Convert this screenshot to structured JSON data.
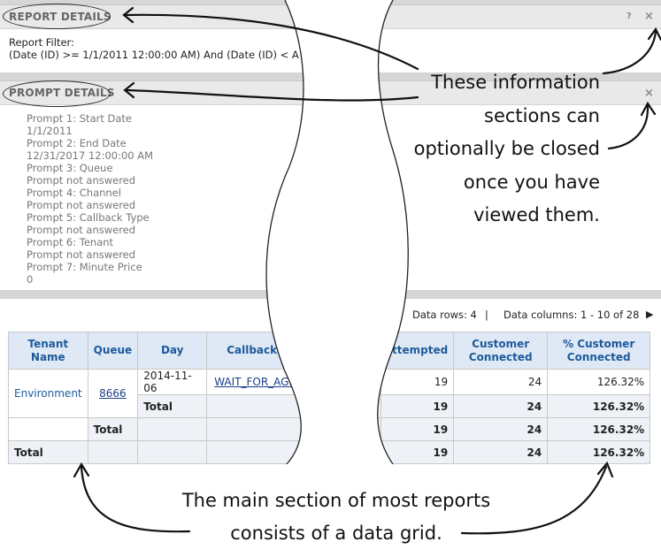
{
  "report_details": {
    "title": "REPORT DETAILS",
    "filter_label": "Report Filter:",
    "filter_value": "(Date (ID) >= 1/1/2011 12:00:00 AM) And (Date (ID) < A",
    "help_icon": "?",
    "close_icon": "×"
  },
  "prompt_details": {
    "title": "PROMPT DETAILS",
    "close_icon": "×",
    "lines": [
      "Prompt 1: Start Date",
      "1/1/2011",
      "Prompt 2: End Date",
      "12/31/2017 12:00:00 AM",
      "Prompt 3: Queue",
      "Prompt not answered",
      "Prompt 4: Channel",
      "Prompt not answered",
      "Prompt 5: Callback Type",
      "Prompt not answered",
      "Prompt 6: Tenant",
      "Prompt not answered",
      "Prompt 7: Minute Price",
      "0"
    ]
  },
  "grid_info": {
    "data_rows": "Data rows: 4",
    "separator": "|",
    "data_columns": "Data columns: 1 - 10 of 28",
    "next_icon": "▶"
  },
  "grid": {
    "headers": [
      "Tenant Name",
      "Queue",
      "Day",
      "Callback Type",
      "ttempted",
      "Customer Connected",
      "% Customer Connected"
    ],
    "rows": [
      {
        "tenant": "Environment",
        "queue": "8666",
        "day": "2014-11-06",
        "callback": "WAIT_FOR_AGEN",
        "attempted": "19",
        "connected": "24",
        "pct": "126.32%"
      },
      {
        "day_total": "Total",
        "attempted": "19",
        "connected": "24",
        "pct": "126.32%"
      },
      {
        "queue_total": "Total",
        "attempted": "19",
        "connected": "24",
        "pct": "126.32%"
      },
      {
        "tenant_total": "Total",
        "attempted": "19",
        "connected": "24",
        "pct": "126.32%"
      }
    ]
  },
  "annotations": {
    "callout_lines": [
      "These information",
      "sections can",
      "optionally be closed",
      "once you have",
      "viewed them."
    ],
    "bottom_lines": [
      "The main section of most reports",
      "consists of a data grid."
    ]
  }
}
